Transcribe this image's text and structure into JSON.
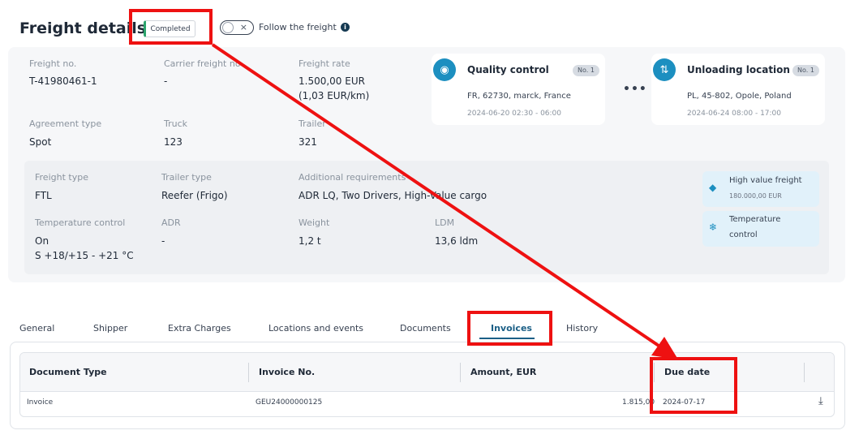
{
  "header": {
    "title": "Freight details",
    "status": "Completed",
    "follow_label": "Follow the freight",
    "toggle_off_symbol": "×",
    "info_symbol": "i"
  },
  "details": {
    "freight_no_label": "Freight no.",
    "freight_no": "T-41980461-1",
    "carrier_freight_no_label": "Carrier freight no",
    "carrier_freight_no": "-",
    "freight_rate_label": "Freight rate",
    "freight_rate": "1.500,00 EUR",
    "freight_rate_per_km": "(1,03 EUR/km)",
    "agreement_type_label": "Agreement type",
    "agreement_type": "Spot",
    "truck_label": "Truck",
    "truck": "123",
    "trailer_label": "Trailer",
    "trailer": "321"
  },
  "locations": {
    "quality_control": {
      "name": "Quality control",
      "no": "No. 1",
      "address": "FR, 62730, marck, France",
      "time": "2024-06-20 02:30 - 06:00"
    },
    "more_symbol": "•••",
    "unloading": {
      "name": "Unloading location",
      "no": "No. 1",
      "address": "PL, 45-802, Opole, Poland",
      "time": "2024-06-24 08:00 - 17:00"
    }
  },
  "specs": {
    "freight_type_label": "Freight type",
    "freight_type": "FTL",
    "trailer_type_label": "Trailer type",
    "trailer_type": "Reefer (Frigo)",
    "additional_label": "Additional requirements",
    "additional": "ADR LQ, Two Drivers, High-Value cargo",
    "temp_control_label": "Temperature control",
    "temp_control": "On",
    "temp_range": "S +18/+15 - +21 °C",
    "adr_label": "ADR",
    "adr": "-",
    "weight_label": "Weight",
    "weight": "1,2 t",
    "ldm_label": "LDM",
    "ldm": "13,6 ldm"
  },
  "chips": {
    "high_value_title": "High value freight",
    "high_value_amount": "180.000,00 EUR",
    "temperature_line1": "Temperature",
    "temperature_line2": "control"
  },
  "tabs": {
    "general": "General",
    "shipper": "Shipper",
    "extra_charges": "Extra Charges",
    "locations": "Locations and events",
    "documents": "Documents",
    "invoices": "Invoices",
    "history": "History"
  },
  "table": {
    "columns": [
      "Document Type",
      "Invoice No.",
      "Amount, EUR",
      "Due date"
    ],
    "rows": [
      [
        "Invoice",
        "GEU24000000125",
        "1.815,00",
        "2024-07-17"
      ]
    ],
    "download_symbol": "⤓"
  },
  "colors": {
    "accent": "#1b5f86",
    "icon_blue": "#1c8fc0",
    "status_green": "#2aa36b",
    "annotation_red": "#ee1111"
  }
}
